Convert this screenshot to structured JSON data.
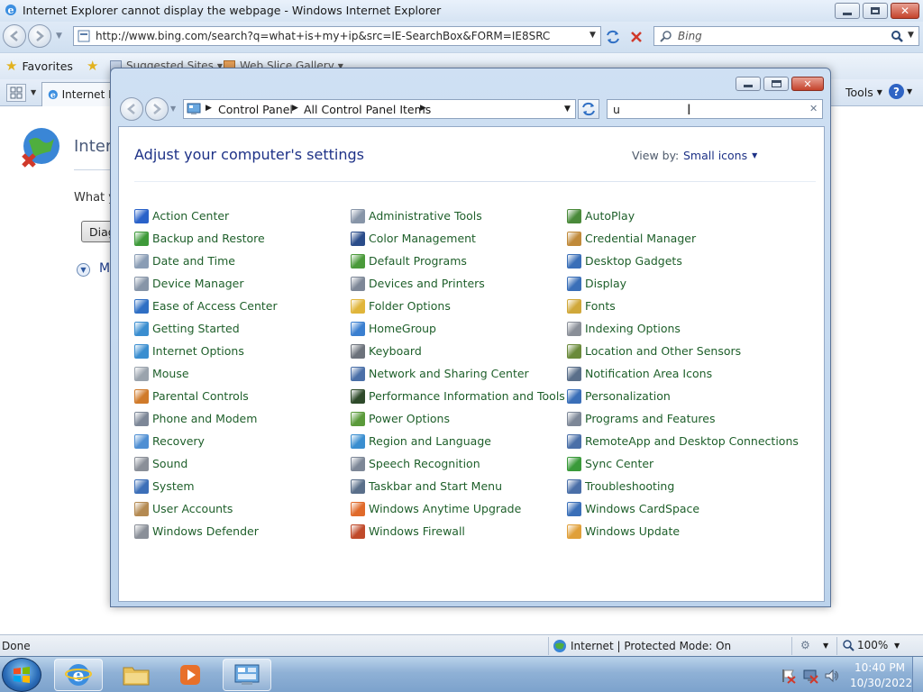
{
  "ie": {
    "title": "Internet Explorer cannot display the webpage - Windows Internet Explorer",
    "address": "http://www.bing.com/search?q=what+is+my+ip&src=IE-SearchBox&FORM=IE8SRC",
    "search_placeholder": "Bing",
    "favorites_label": "Favorites",
    "suggested_sites": "Suggested Sites",
    "web_slice": "Web Slice Gallery",
    "tab_label": "Internet Ex",
    "tools_label": "Tools",
    "page_heading_partial": "Intern",
    "page_text_partial": "What y",
    "diag_button_partial": "Diag",
    "more_partial": "M",
    "status_left": "Done",
    "status_zone": "Internet | Protected Mode: On",
    "zoom": "100%"
  },
  "cp": {
    "breadcrumb": [
      "Control Panel",
      "All Control Panel Items"
    ],
    "search_value": "u",
    "heading": "Adjust your computer's settings",
    "view_by_label": "View by:",
    "view_by_value": "Small icons",
    "columns": [
      [
        {
          "label": "Action Center",
          "color": "#2a62c9"
        },
        {
          "label": "Backup and Restore",
          "color": "#3e9a3a"
        },
        {
          "label": "Date and Time",
          "color": "#8a9db5"
        },
        {
          "label": "Device Manager",
          "color": "#8795a8"
        },
        {
          "label": "Ease of Access Center",
          "color": "#2f6fc4"
        },
        {
          "label": "Getting Started",
          "color": "#3a8ed0"
        },
        {
          "label": "Internet Options",
          "color": "#3a8ed0"
        },
        {
          "label": "Mouse",
          "color": "#9aa3ad"
        },
        {
          "label": "Parental Controls",
          "color": "#d07a2a"
        },
        {
          "label": "Phone and Modem",
          "color": "#7d8797"
        },
        {
          "label": "Recovery",
          "color": "#4f8fd3"
        },
        {
          "label": "Sound",
          "color": "#8a8f98"
        },
        {
          "label": "System",
          "color": "#3c6fb8"
        },
        {
          "label": "User Accounts",
          "color": "#b48a52"
        },
        {
          "label": "Windows Defender",
          "color": "#8a8f98"
        }
      ],
      [
        {
          "label": "Administrative Tools",
          "color": "#8795a8"
        },
        {
          "label": "Color Management",
          "color": "#2a4c8a"
        },
        {
          "label": "Default Programs",
          "color": "#4a9a3a"
        },
        {
          "label": "Devices and Printers",
          "color": "#7d8797"
        },
        {
          "label": "Folder Options",
          "color": "#e0b53a"
        },
        {
          "label": "HomeGroup",
          "color": "#3a7fd0"
        },
        {
          "label": "Keyboard",
          "color": "#6c727b"
        },
        {
          "label": "Network and Sharing Center",
          "color": "#4a6fa8"
        },
        {
          "label": "Performance Information and Tools",
          "color": "#2e4a2a"
        },
        {
          "label": "Power Options",
          "color": "#5a9a3a"
        },
        {
          "label": "Region and Language",
          "color": "#3a8ed0"
        },
        {
          "label": "Speech Recognition",
          "color": "#7d8797"
        },
        {
          "label": "Taskbar and Start Menu",
          "color": "#5a6f8a"
        },
        {
          "label": "Windows Anytime Upgrade",
          "color": "#e06a2a"
        },
        {
          "label": "Windows Firewall",
          "color": "#c04a2a"
        }
      ],
      [
        {
          "label": "AutoPlay",
          "color": "#4a8a3a"
        },
        {
          "label": "Credential Manager",
          "color": "#c08a3a"
        },
        {
          "label": "Desktop Gadgets",
          "color": "#3a6fb8"
        },
        {
          "label": "Display",
          "color": "#3a6fb8"
        },
        {
          "label": "Fonts",
          "color": "#d0a83a"
        },
        {
          "label": "Indexing Options",
          "color": "#8a8f98"
        },
        {
          "label": "Location and Other Sensors",
          "color": "#6a8a3a"
        },
        {
          "label": "Notification Area Icons",
          "color": "#5a6f8a"
        },
        {
          "label": "Personalization",
          "color": "#3a6fb8"
        },
        {
          "label": "Programs and Features",
          "color": "#7d8797"
        },
        {
          "label": "RemoteApp and Desktop Connections",
          "color": "#4a6fa8"
        },
        {
          "label": "Sync Center",
          "color": "#3a9a3a"
        },
        {
          "label": "Troubleshooting",
          "color": "#4a6fa8"
        },
        {
          "label": "Windows CardSpace",
          "color": "#3a6fb8"
        },
        {
          "label": "Windows Update",
          "color": "#e0a03a"
        }
      ]
    ]
  },
  "taskbar": {
    "time": "10:40 PM",
    "date": "10/30/2022"
  }
}
